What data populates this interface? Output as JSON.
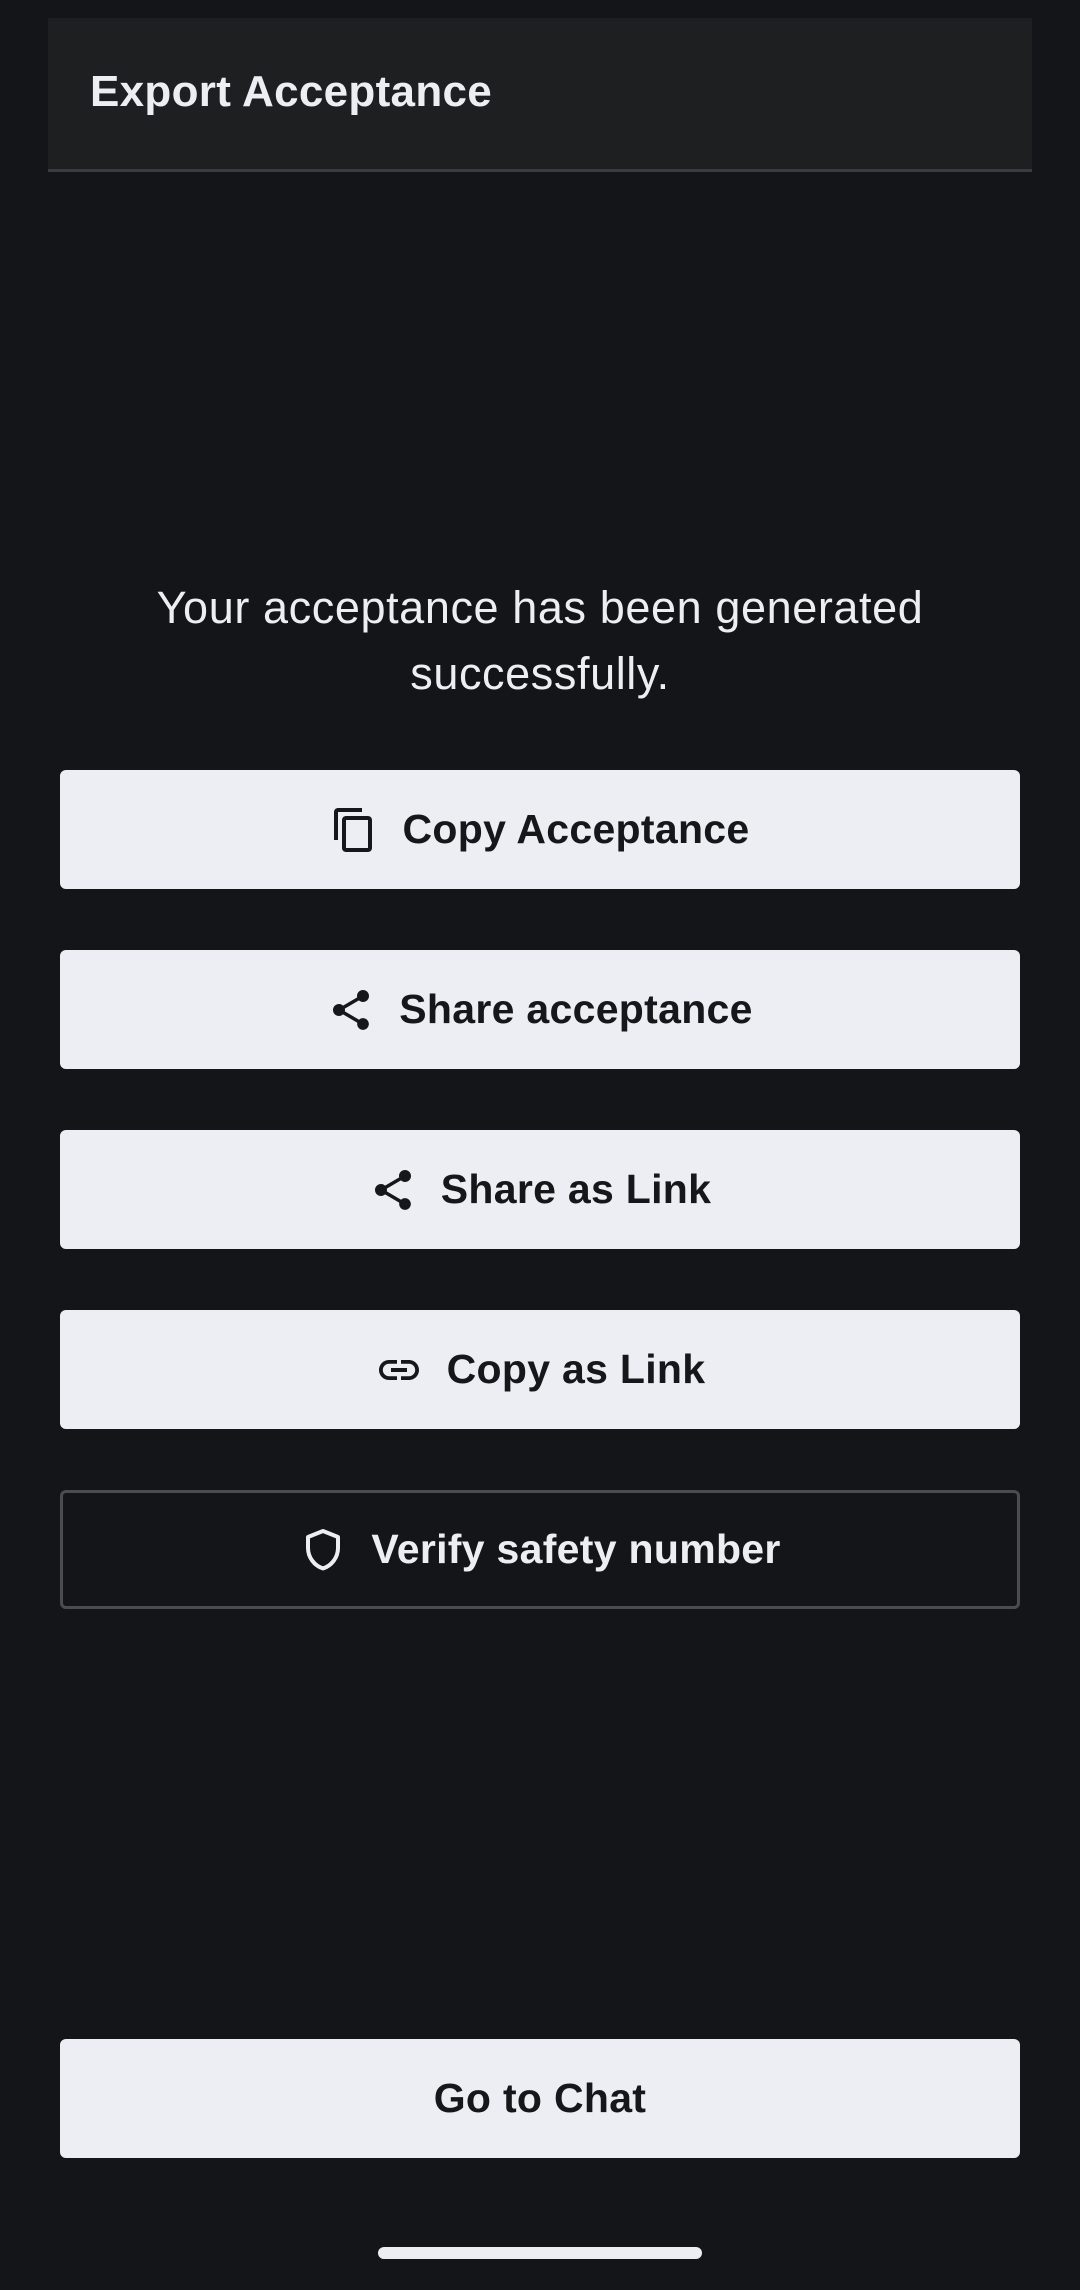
{
  "header": {
    "title": "Export Acceptance"
  },
  "main": {
    "message": "Your acceptance has been generated successfully.",
    "buttons": [
      {
        "label": "Copy Acceptance",
        "icon": "copy-icon"
      },
      {
        "label": "Share acceptance",
        "icon": "share-icon"
      },
      {
        "label": "Share as Link",
        "icon": "share-icon"
      },
      {
        "label": "Copy as Link",
        "icon": "link-icon"
      },
      {
        "label": "Verify safety number",
        "icon": "shield-icon"
      }
    ]
  },
  "footer": {
    "go_to_chat_label": "Go to Chat"
  },
  "colors": {
    "background": "#141518",
    "header_background": "#1e1f21",
    "button_background": "#eceef3",
    "button_text": "#16171a",
    "text_light": "#eceef2"
  }
}
